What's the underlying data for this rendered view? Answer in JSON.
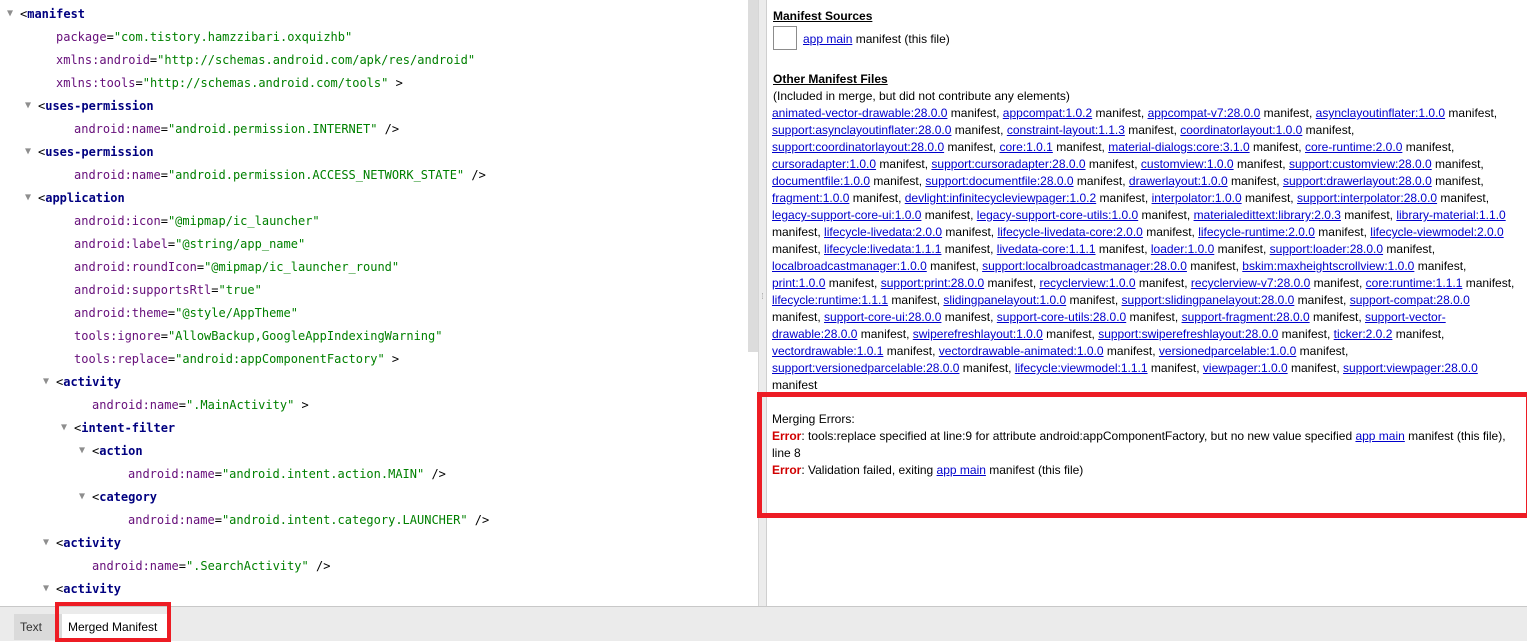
{
  "xml_tree": {
    "lines": [
      {
        "indent": 0,
        "toggle": true,
        "open": "<",
        "tag": "manifest"
      },
      {
        "indent": 2,
        "attr": "package",
        "val": "\"com.tistory.hamzzibari.oxquizhb\""
      },
      {
        "indent": 2,
        "attr": "xmlns:android",
        "val": "\"http://schemas.android.com/apk/res/android\""
      },
      {
        "indent": 2,
        "attr": "xmlns:tools",
        "val": "\"http://schemas.android.com/tools\"",
        "close": " >"
      },
      {
        "indent": 1,
        "toggle": true,
        "open": "<",
        "tag": "uses-permission"
      },
      {
        "indent": 3,
        "attr": "android:name",
        "val": "\"android.permission.INTERNET\"",
        "close": " />"
      },
      {
        "indent": 1,
        "toggle": true,
        "open": "<",
        "tag": "uses-permission"
      },
      {
        "indent": 3,
        "attr": "android:name",
        "val": "\"android.permission.ACCESS_NETWORK_STATE\"",
        "close": " />"
      },
      {
        "indent": 1,
        "toggle": true,
        "open": "<",
        "tag": "application"
      },
      {
        "indent": 3,
        "attr": "android:icon",
        "val": "\"@mipmap/ic_launcher\""
      },
      {
        "indent": 3,
        "attr": "android:label",
        "val": "\"@string/app_name\""
      },
      {
        "indent": 3,
        "attr": "android:roundIcon",
        "val": "\"@mipmap/ic_launcher_round\""
      },
      {
        "indent": 3,
        "attr": "android:supportsRtl",
        "val": "\"true\""
      },
      {
        "indent": 3,
        "attr": "android:theme",
        "val": "\"@style/AppTheme\""
      },
      {
        "indent": 3,
        "attr": "tools:ignore",
        "val": "\"AllowBackup,GoogleAppIndexingWarning\""
      },
      {
        "indent": 3,
        "attr": "tools:replace",
        "val": "\"android:appComponentFactory\"",
        "close": " >"
      },
      {
        "indent": 2,
        "toggle": true,
        "open": "<",
        "tag": "activity"
      },
      {
        "indent": 4,
        "attr": "android:name",
        "val": "\".MainActivity\"",
        "close": " >"
      },
      {
        "indent": 3,
        "toggle": true,
        "open": "<",
        "tag": "intent-filter"
      },
      {
        "indent": 4,
        "toggle": true,
        "open": "<",
        "tag": "action"
      },
      {
        "indent": 6,
        "attr": "android:name",
        "val": "\"android.intent.action.MAIN\"",
        "close": " />"
      },
      {
        "indent": 4,
        "toggle": true,
        "open": "<",
        "tag": "category"
      },
      {
        "indent": 6,
        "attr": "android:name",
        "val": "\"android.intent.category.LAUNCHER\"",
        "close": " />"
      },
      {
        "indent": 2,
        "toggle": true,
        "open": "<",
        "tag": "activity"
      },
      {
        "indent": 4,
        "attr": "android:name",
        "val": "\".SearchActivity\"",
        "close": " />"
      },
      {
        "indent": 2,
        "toggle": true,
        "open": "<",
        "tag": "activity"
      }
    ]
  },
  "manifest_sources": {
    "title": "Manifest Sources",
    "link": "app main",
    "suffix": " manifest (this file)"
  },
  "other_files": {
    "title": "Other Manifest Files",
    "subtitle": "(Included in merge, but did not contribute any elements)",
    "suffix": " manifest",
    "items": [
      "animated-vector-drawable:28.0.0",
      "appcompat:1.0.2",
      "appcompat-v7:28.0.0",
      "asynclayoutinflater:1.0.0",
      "support:asynclayoutinflater:28.0.0",
      "constraint-layout:1.1.3",
      "coordinatorlayout:1.0.0",
      "support:coordinatorlayout:28.0.0",
      "core:1.0.1",
      "material-dialogs:core:3.1.0",
      "core-runtime:2.0.0",
      "cursoradapter:1.0.0",
      "support:cursoradapter:28.0.0",
      "customview:1.0.0",
      "support:customview:28.0.0",
      "documentfile:1.0.0",
      "support:documentfile:28.0.0",
      "drawerlayout:1.0.0",
      "support:drawerlayout:28.0.0",
      "fragment:1.0.0",
      "devlight:infinitecycleviewpager:1.0.2",
      "interpolator:1.0.0",
      "support:interpolator:28.0.0",
      "legacy-support-core-ui:1.0.0",
      "legacy-support-core-utils:1.0.0",
      "materialedittext:library:2.0.3",
      "library-material:1.1.0",
      "lifecycle-livedata:2.0.0",
      "lifecycle-livedata-core:2.0.0",
      "lifecycle-runtime:2.0.0",
      "lifecycle-viewmodel:2.0.0",
      "lifecycle:livedata:1.1.1",
      "livedata-core:1.1.1",
      "loader:1.0.0",
      "support:loader:28.0.0",
      "localbroadcastmanager:1.0.0",
      "support:localbroadcastmanager:28.0.0",
      "bskim:maxheightscrollview:1.0.0",
      "print:1.0.0",
      "support:print:28.0.0",
      "recyclerview:1.0.0",
      "recyclerview-v7:28.0.0",
      "core:runtime:1.1.1",
      "lifecycle:runtime:1.1.1",
      "slidingpanelayout:1.0.0",
      "support:slidingpanelayout:28.0.0",
      "support-compat:28.0.0",
      "support-core-ui:28.0.0",
      "support-core-utils:28.0.0",
      "support-fragment:28.0.0",
      "support-vector-drawable:28.0.0",
      "swiperefreshlayout:1.0.0",
      "support:swiperefreshlayout:28.0.0",
      "ticker:2.0.2",
      "vectordrawable:1.0.1",
      "vectordrawable-animated:1.0.0",
      "versionedparcelable:1.0.0",
      "support:versionedparcelable:28.0.0",
      "lifecycle:viewmodel:1.1.1",
      "viewpager:1.0.0",
      "support:viewpager:28.0.0"
    ]
  },
  "merging_errors": {
    "title": "Merging Errors:",
    "errors": [
      {
        "label": "Error",
        "text": ": tools:replace specified at line:9 for attribute android:appComponentFactory, but no new value specified ",
        "link": "app main",
        "tail": " manifest (this file), line 8"
      },
      {
        "label": "Error",
        "text": ": Validation failed, exiting ",
        "link": "app main",
        "tail": " manifest (this file)"
      }
    ]
  },
  "tabs": {
    "text": "Text",
    "merged": "Merged Manifest"
  },
  "colors": {
    "highlight": "#ed1c24",
    "link": "#0000cc",
    "error": "#d00000"
  }
}
